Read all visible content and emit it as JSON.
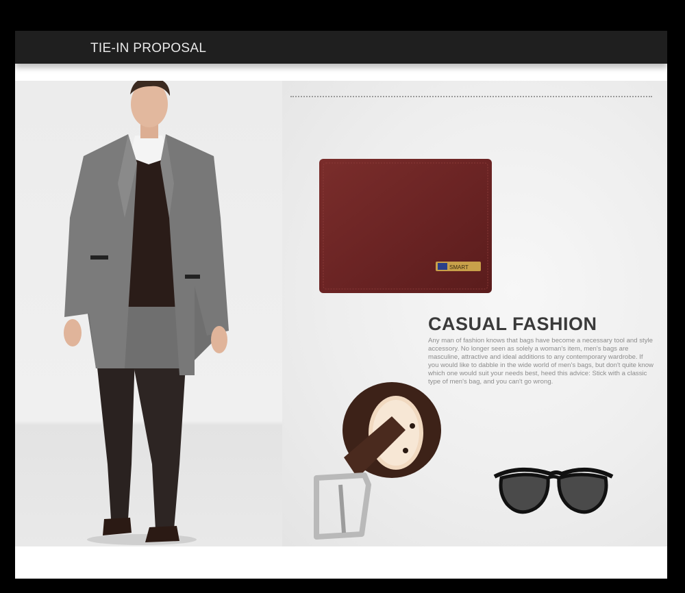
{
  "header": {
    "title": "TIE-IN PROPOSAL"
  },
  "feature": {
    "title": "CASUAL FASHION",
    "body": "Any man of fashion knows that bags have become a necessary tool and style accessory. No longer seen as solely a woman's item, men's bags are masculine, attractive and ideal additions to any contemporary wardrobe. If you would like to dabble in the wide world of men's bags, but don't quite know which one would suit your needs best, heed this advice: Stick with a classic type of men's bag, and you can't go wrong."
  },
  "products": {
    "wallet_badge": "SMART"
  },
  "colors": {
    "background": "#000000",
    "header_bar": "#1f1f1f",
    "wallet_leather": "#6b2424",
    "belt_leather": "#3d2218"
  },
  "icons": [
    "wallet-icon",
    "belt-icon",
    "sunglasses-icon",
    "model-figure"
  ]
}
